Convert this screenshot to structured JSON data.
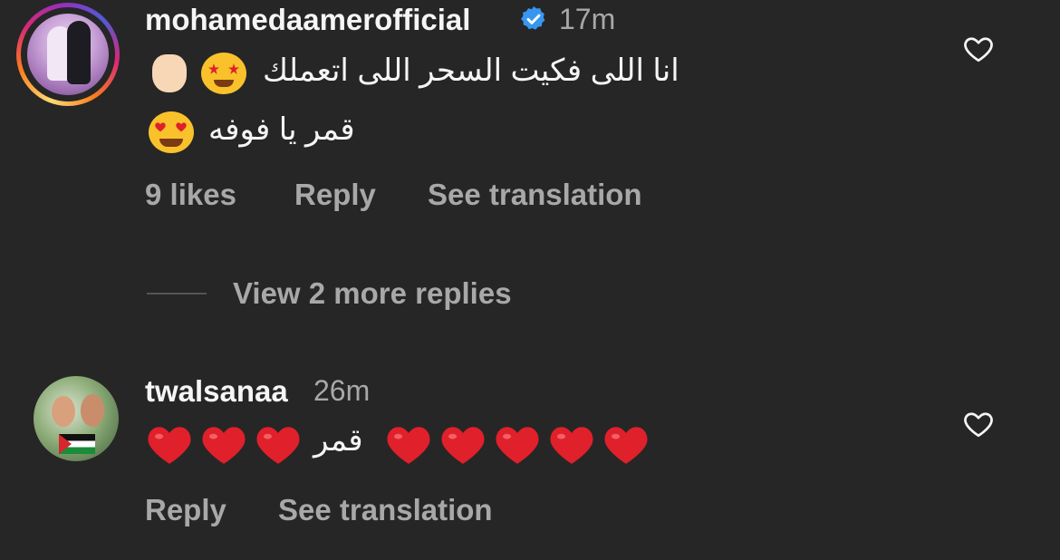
{
  "comments": [
    {
      "username": "mohamedaamerofficial",
      "time": "17m",
      "line1": "انا اللى فكيت السحر اللى اتعملك",
      "line2": "قمر يا فوفه",
      "likes": "9 likes",
      "reply": "Reply",
      "translate": "See translation",
      "view_replies": "View 2 more replies"
    },
    {
      "username": "twalsanaa",
      "time": "26m",
      "line1": "قمر",
      "reply": "Reply",
      "translate": "See translation"
    }
  ],
  "icons": {
    "like": "heart-outline-icon",
    "verified": "verified-badge-icon"
  },
  "colors": {
    "background": "#262626",
    "verified": "#3797f0",
    "muted_text": "#a8a8a8",
    "heart_emoji": "#e0202a"
  }
}
